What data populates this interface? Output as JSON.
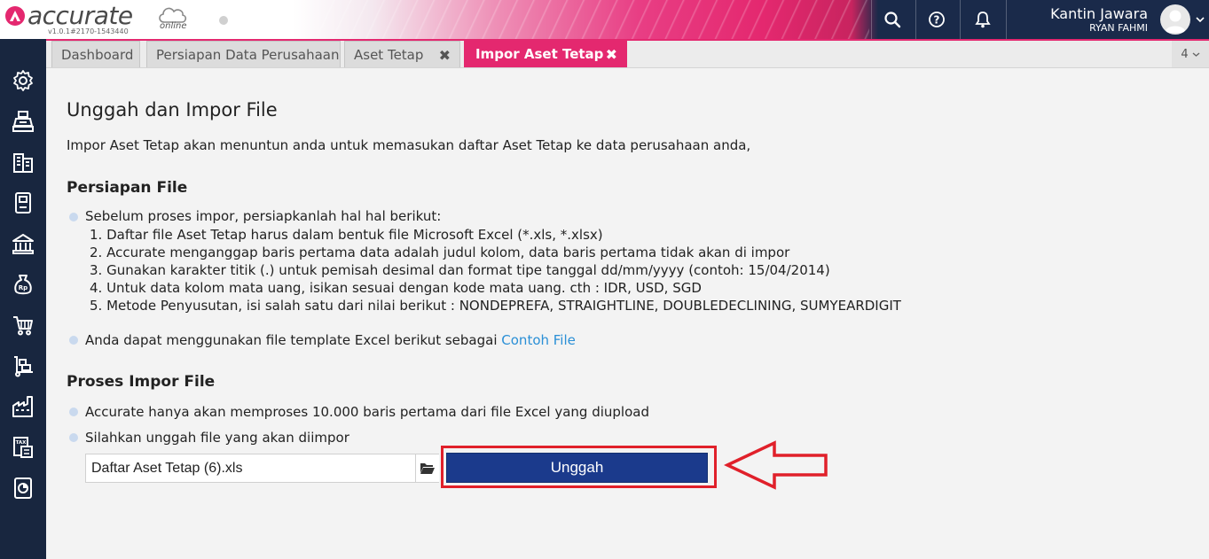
{
  "app": {
    "logo_text": "accurate",
    "logo_sub": "online",
    "version": "v1.0.1#2170-1543440"
  },
  "topbar": {
    "icons": [
      "search-icon",
      "help-icon",
      "bell-icon"
    ],
    "company": "Kantin Jawara",
    "user": "RYAN FAHMI"
  },
  "sidebar": {
    "icons": [
      "gear-icon",
      "cash-register-icon",
      "building-icon",
      "ledger-icon",
      "bank-icon",
      "money-bag-icon",
      "cart-icon",
      "dolly-icon",
      "factory-icon",
      "tax-icon",
      "report-icon"
    ]
  },
  "tabs": [
    {
      "label": "Dashboard",
      "closable": false,
      "active": false
    },
    {
      "label": "Persiapan Data Perusahaan",
      "closable": false,
      "active": false
    },
    {
      "label": "Aset Tetap",
      "closable": true,
      "active": false
    },
    {
      "label": "Impor Aset Tetap",
      "closable": true,
      "active": true
    }
  ],
  "tab_count": "4",
  "page": {
    "title": "Unggah dan Impor File",
    "intro": "Impor Aset Tetap akan menuntun anda untuk memasukan daftar Aset Tetap ke data perusahaan anda,",
    "prep_heading": "Persiapan File",
    "prep_bullet": "Sebelum proses impor, persiapkanlah hal hal berikut:",
    "prep_items": [
      "1. Daftar file Aset Tetap harus dalam bentuk file Microsoft Excel (*.xls, *.xlsx)",
      "2. Accurate menganggap baris pertama data adalah judul kolom, data baris pertama tidak akan di impor",
      "3. Gunakan karakter titik (.) untuk pemisah desimal dan format tipe tanggal dd/mm/yyyy (contoh: 15/04/2014)",
      "4. Untuk data kolom mata uang, isikan sesuai dengan kode mata uang. cth : IDR, USD, SGD",
      "5. Metode Penyusutan, isi salah satu dari nilai berikut : NONDEPREFA, STRAIGHTLINE, DOUBLEDECLINING, SUMYEARDIGIT"
    ],
    "template_text": "Anda dapat menggunakan file template Excel berikut sebagai ",
    "template_link": "Contoh File",
    "process_heading": "Proses Impor File",
    "process_bullet_1": "Accurate hanya akan memproses 10.000 baris pertama dari file Excel yang diupload",
    "process_bullet_2": "Silahkan unggah file yang akan diimpor",
    "file_value": "Daftar Aset Tetap (6).xls",
    "upload_label": "Unggah"
  },
  "colors": {
    "accent": "#e4286f",
    "sidebar": "#18263f",
    "upload_button": "#1b3a8c",
    "highlight": "#e0202a",
    "link": "#2a8fd6"
  }
}
